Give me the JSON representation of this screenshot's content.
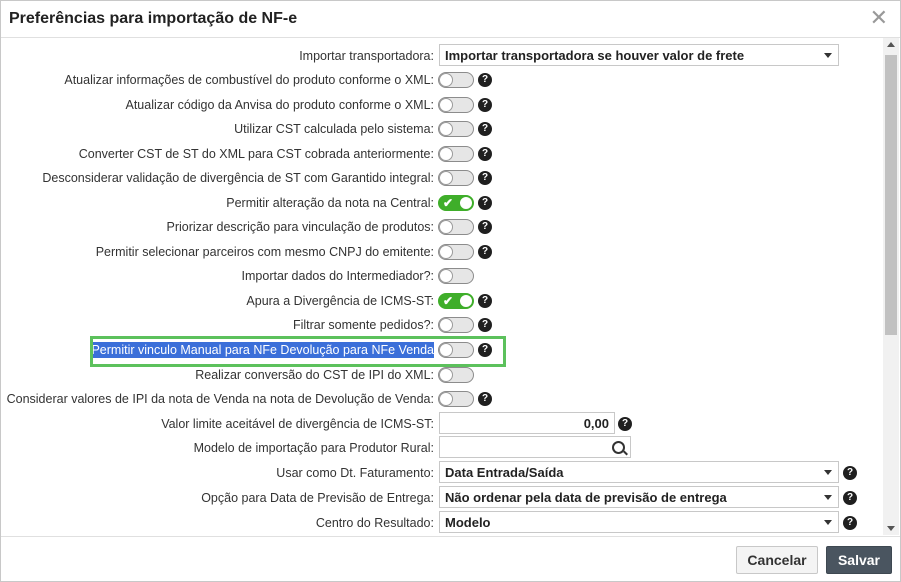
{
  "dialog": {
    "title": "Preferências para importação de NF-e",
    "close_glyph": "✕"
  },
  "rows": [
    {
      "label": "Importar transportadora:",
      "type": "select",
      "value": "Importar transportadora se houver valor de frete",
      "help": false
    },
    {
      "label": "Atualizar informações de combustível do produto conforme o XML:",
      "type": "toggle",
      "on": false,
      "help": true
    },
    {
      "label": "Atualizar código da Anvisa do produto conforme o XML:",
      "type": "toggle",
      "on": false,
      "help": true
    },
    {
      "label": "Utilizar CST calculada pelo sistema:",
      "type": "toggle",
      "on": false,
      "help": true
    },
    {
      "label": "Converter CST de ST do XML para CST cobrada anteriormente:",
      "type": "toggle",
      "on": false,
      "help": true
    },
    {
      "label": "Desconsiderar validação de divergência de ST com Garantido integral:",
      "type": "toggle",
      "on": false,
      "help": true
    },
    {
      "label": "Permitir alteração da nota na Central:",
      "type": "toggle",
      "on": true,
      "help": true
    },
    {
      "label": "Priorizar descrição para vinculação de produtos:",
      "type": "toggle",
      "on": false,
      "help": true
    },
    {
      "label": "Permitir selecionar parceiros com mesmo CNPJ do emitente:",
      "type": "toggle",
      "on": false,
      "help": true
    },
    {
      "label": "Importar dados do Intermediador?:",
      "type": "toggle",
      "on": false,
      "help": false
    },
    {
      "label": "Apura a Divergência de ICMS-ST:",
      "type": "toggle",
      "on": true,
      "help": true
    },
    {
      "label": "Filtrar somente pedidos?:",
      "type": "toggle",
      "on": false,
      "help": true
    },
    {
      "label": "Permitir vinculo Manual para NFe Devolução para NFe Venda",
      "type": "toggle",
      "on": false,
      "help": true,
      "selected": true
    },
    {
      "label": "Realizar conversão do CST de IPI do XML:",
      "type": "toggle",
      "on": false,
      "help": false
    },
    {
      "label": "Considerar valores de IPI da nota de Venda na nota de Devolução de Venda:",
      "type": "toggle",
      "on": false,
      "help": true
    },
    {
      "label": "Valor limite aceitável de divergência de ICMS-ST:",
      "type": "number",
      "value": "0,00",
      "help": true
    },
    {
      "label": "Modelo de importação para Produtor Rural:",
      "type": "search",
      "value": "",
      "help": false
    },
    {
      "label": "Usar como Dt. Faturamento:",
      "type": "select2",
      "value": "Data Entrada/Saída",
      "help": true
    },
    {
      "label": "Opção para Data de Previsão de Entrega:",
      "type": "select2",
      "value": "Não ordenar pela data de previsão de entrega",
      "help": true
    },
    {
      "label": "Centro do Resultado:",
      "type": "select2",
      "value": "Modelo",
      "help": true
    }
  ],
  "help_glyph": "?",
  "check_glyph": "✔",
  "footer": {
    "cancel_label": "Cancelar",
    "save_label": "Salvar"
  },
  "colors": {
    "toggle_on": "#3fae2a",
    "selection": "#3b6fd9",
    "highlight_border": "#5cc15c",
    "save_button": "#4a5560"
  }
}
